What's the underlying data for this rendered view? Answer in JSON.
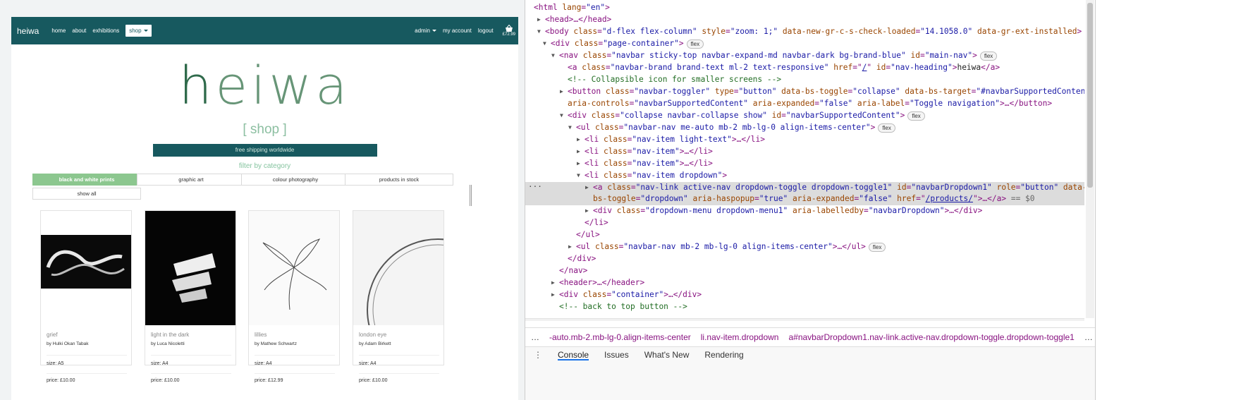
{
  "site": {
    "brand": "heiwa",
    "nav_items": [
      "home",
      "about",
      "exhibitions"
    ],
    "shop_label": "shop",
    "right_items": {
      "admin": "admin",
      "account": "my account",
      "logout": "logout"
    },
    "basket_total": "£72.99",
    "logo_first": "h",
    "logo_rest": "eiwa",
    "subtitle": "[ shop ]",
    "shipping_banner": "free shipping worldwide",
    "filter_title": "filter by category",
    "filters": [
      "black and white prints",
      "graphic art",
      "colour photography",
      "products in stock",
      "show all"
    ],
    "products": [
      {
        "title": "grief",
        "by": "by Hulki Okan Tabak",
        "size": "size: A5",
        "price": "price: £10.00"
      },
      {
        "title": "light in the dark",
        "by": "by Luca Nicoletti",
        "size": "size: A4",
        "price": "price: £10.00"
      },
      {
        "title": "lillies",
        "by": "by Mathew Schwartz",
        "size": "size: A4",
        "price": "price: £12.99"
      },
      {
        "title": "london eye",
        "by": "by Adam Birkett",
        "size": "size: A4",
        "price": "price: £10.00"
      }
    ]
  },
  "devtools": {
    "l1": {
      "tag": "<html ",
      "a1": "lang",
      "v1": "\"en\"",
      "end": ">"
    },
    "l2": {
      "text": "<head>…</head>"
    },
    "l3": {
      "tag": "<body ",
      "a1": "class",
      "v1": "\"d-flex flex-column\"",
      "a2": " style",
      "v2": "\"zoom: 1;\"",
      "a3": " data-new-gr-c-s-check-loaded",
      "v3": "\"14.1058.0\"",
      "a4": " data-gr-ext-installed",
      "end": ">",
      "badge": "flex"
    },
    "l4": {
      "tag": "<div ",
      "a1": "class",
      "v1": "\"page-container\"",
      "end": ">",
      "badge": "flex"
    },
    "l5": {
      "tag": "<nav ",
      "a1": "class",
      "v1": "\"navbar sticky-top navbar-expand-md navbar-dark bg-brand-blue\"",
      "a2": " id",
      "v2": "\"main-nav\"",
      "end": ">",
      "badge": "flex"
    },
    "l6": {
      "tag": "<a ",
      "a1": "class",
      "v1": "\"navbar-brand brand-text ml-2 text-responsive\"",
      "a2": " href",
      "v2": "/",
      "a3": " id",
      "v3": "\"nav-heading\"",
      "text": "heiwa",
      "end": "</a>"
    },
    "l7": {
      "comment": "<!-- Collapsible icon for smaller screens -->"
    },
    "l8": {
      "tag": "<button ",
      "a1": "class",
      "v1": "\"navbar-toggler\"",
      "a2": " type",
      "v2": "\"button\"",
      "a3": " data-bs-toggle",
      "v3": "\"collapse\"",
      "a4": " data-bs-target",
      "v4": "\"#navbarSupportedContent\""
    },
    "l9": {
      "a1": "aria-controls",
      "v1": "\"navbarSupportedContent\"",
      "a2": " aria-expanded",
      "v2": "\"false\"",
      "a3": " aria-label",
      "v3": "\"Toggle navigation\"",
      "end": ">…</button>"
    },
    "l10": {
      "tag": "<div ",
      "a1": "class",
      "v1": "\"collapse navbar-collapse show\"",
      "a2": " id",
      "v2": "\"navbarSupportedContent\"",
      "end": ">",
      "badge": "flex"
    },
    "l11": {
      "tag": "<ul ",
      "a1": "class",
      "v1": "\"navbar-nav me-auto mb-2 mb-lg-0 align-items-center\"",
      "end": ">",
      "badge": "flex"
    },
    "l12": {
      "tag": "<li ",
      "a1": "class",
      "v1": "\"nav-item light-text\"",
      "end": ">…</li>"
    },
    "l13": {
      "tag": "<li ",
      "a1": "class",
      "v1": "\"nav-item\"",
      "end": ">…</li>"
    },
    "l14": {
      "tag": "<li ",
      "a1": "class",
      "v1": "\"nav-item\"",
      "end": ">…</li>"
    },
    "l15": {
      "tag": "<li ",
      "a1": "class",
      "v1": "\"nav-item dropdown\"",
      "end": ">"
    },
    "l16": {
      "tag": "<a ",
      "a1": "class",
      "v1": "\"nav-link   active-nav  dropdown-toggle dropdown-toggle1\"",
      "a2": " id",
      "v2": "\"navbarDropdown1\"",
      "a3": " role",
      "v3": "\"button\"",
      "a4": " data-"
    },
    "l17": {
      "a1": "bs-toggle",
      "v1": "\"dropdown\"",
      "a2": " aria-haspopup",
      "v2": "\"true\"",
      "a3": " aria-expanded",
      "v3": "\"false\"",
      "a4": " href",
      "v4": "/products/",
      "end": ">…</a>",
      "eq": " == $0"
    },
    "l18": {
      "tag": "<div ",
      "a1": "class",
      "v1": "\"dropdown-menu dropdown-menu1\"",
      "a2": " aria-labelledby",
      "v2": "\"navbarDropdown\"",
      "end": ">…</div>"
    },
    "l19": {
      "text": "</li>"
    },
    "l20": {
      "text": "</ul>"
    },
    "l21": {
      "tag": "<ul ",
      "a1": "class",
      "v1": "\"navbar-nav mb-2 mb-lg-0 align-items-center\"",
      "end": ">…</ul>",
      "badge": "flex"
    },
    "l22": {
      "text": "</div>"
    },
    "l23": {
      "text": "</nav>"
    },
    "l24": {
      "text": "<header>…</header>"
    },
    "l25": {
      "tag": "<div ",
      "a1": "class",
      "v1": "\"container\"",
      "end": ">…</div>"
    },
    "l26": {
      "comment": "<!-- back to top button -->"
    },
    "breadcrumbs": [
      "…",
      "-auto.mb-2.mb-lg-0.align-items-center",
      "li.nav-item.dropdown",
      "a#navbarDropdown1.nav-link.active-nav.dropdown-toggle.dropdown-toggle1",
      "…"
    ],
    "drawer_tabs": [
      "Console",
      "Issues",
      "What's New",
      "Rendering"
    ]
  }
}
